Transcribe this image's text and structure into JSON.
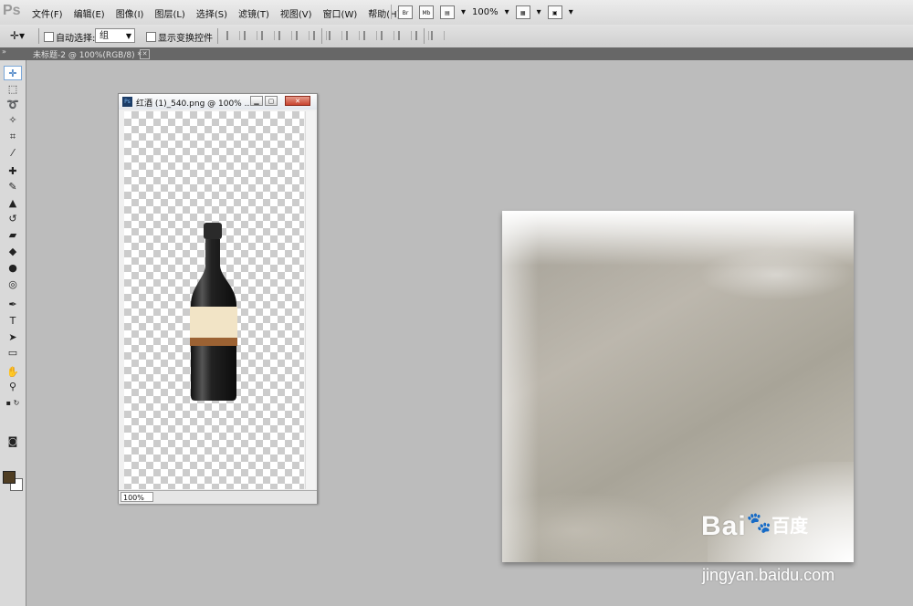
{
  "app": {
    "logo": "Ps"
  },
  "menu": [
    "文件(F)",
    "编辑(E)",
    "图像(I)",
    "图层(L)",
    "选择(S)",
    "滤镜(T)",
    "视图(V)",
    "窗口(W)",
    "帮助(H)"
  ],
  "menubar_tools": {
    "br": "Br",
    "mb": "Mb",
    "zoom": "100%"
  },
  "options": {
    "auto_select_label": "自动选择:",
    "auto_select_value": "组",
    "show_transform_label": "显示变换控件"
  },
  "tab": {
    "label": "未标题-2 @ 100%(RGB/8) *"
  },
  "doc_window": {
    "title": "红酒 (1)_540.png @ 100% ...",
    "zoom": "100%"
  },
  "colors": {
    "foreground": "#4f3d22",
    "background": "#ffffff"
  },
  "watermark": {
    "logo_prefix": "Bai",
    "logo_suffix": "百度",
    "url": "jingyan.baidu.com"
  },
  "tools": [
    "move-tool",
    "marquee-tool",
    "lasso-tool",
    "quick-select-tool",
    "crop-tool",
    "eyedropper-tool",
    "healing-tool",
    "brush-tool",
    "stamp-tool",
    "history-brush-tool",
    "eraser-tool",
    "paint-bucket-tool",
    "blur-tool",
    "dodge-tool",
    "pen-tool",
    "type-tool",
    "path-select-tool",
    "shape-tool",
    "hand-tool",
    "zoom-tool"
  ]
}
